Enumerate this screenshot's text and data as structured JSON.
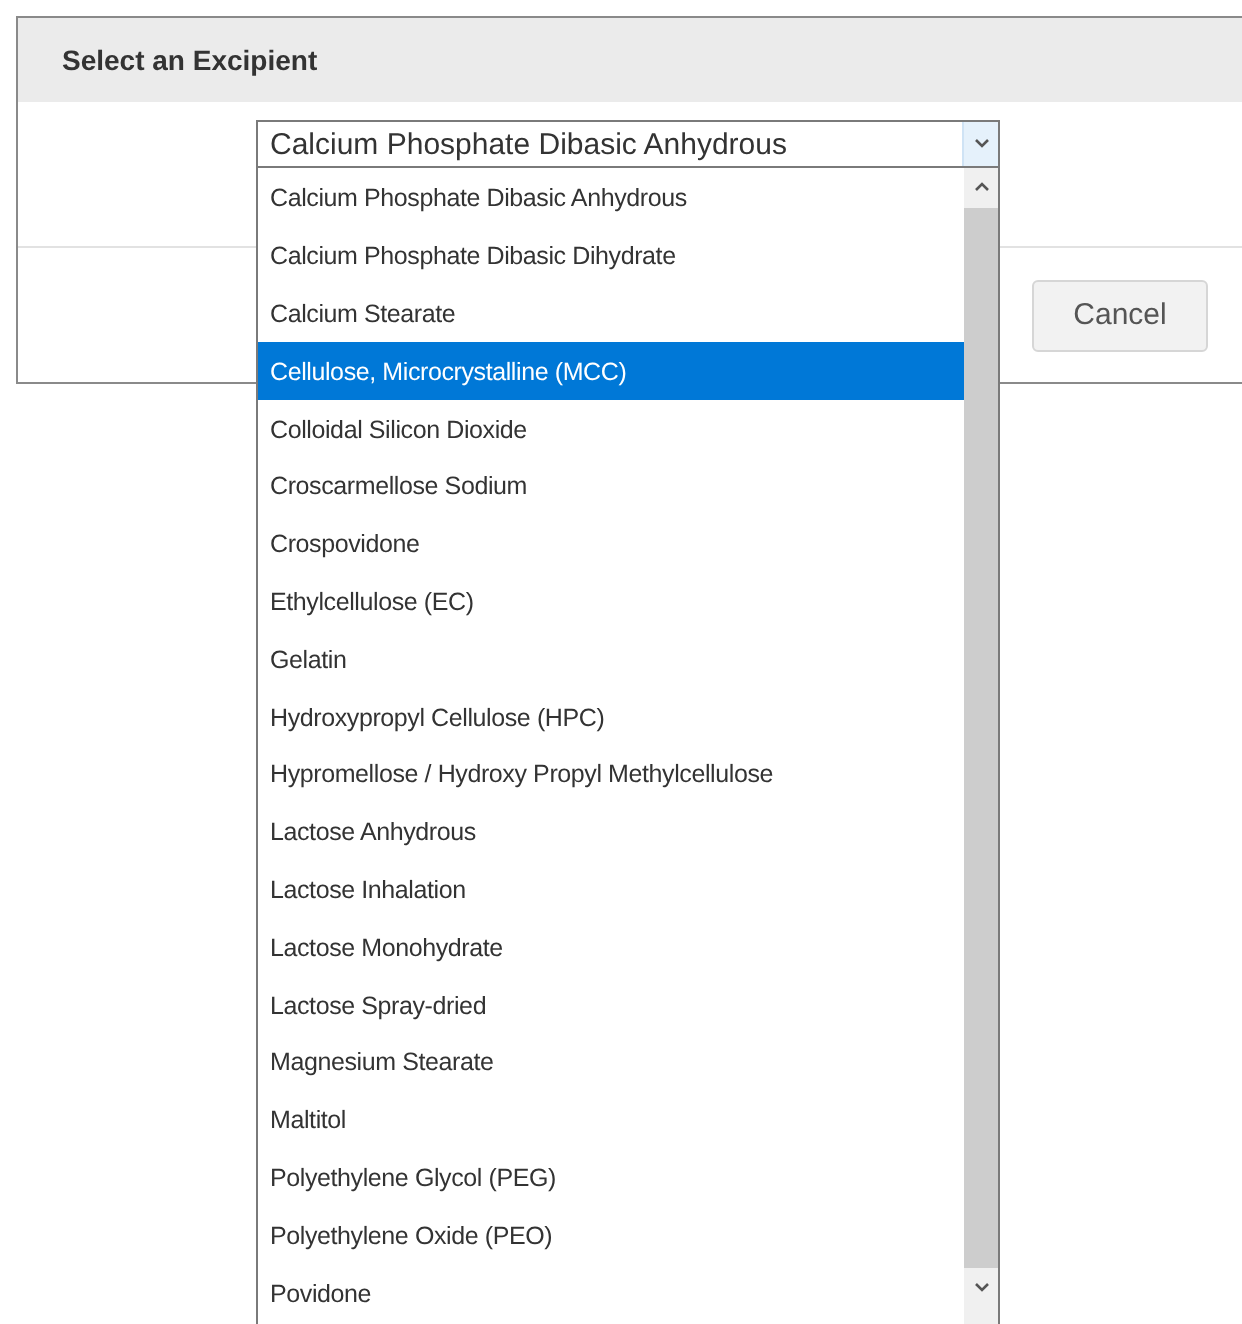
{
  "dialog": {
    "title": "Select an Excipient"
  },
  "combo": {
    "value": "Calcium Phosphate Dibasic Anhydrous",
    "options": [
      {
        "label": "Calcium Phosphate Dibasic Anhydrous",
        "highlighted": false
      },
      {
        "label": "Calcium Phosphate Dibasic Dihydrate",
        "highlighted": false
      },
      {
        "label": "Calcium Stearate",
        "highlighted": false
      },
      {
        "label": "Cellulose, Microcrystalline (MCC)",
        "highlighted": true
      },
      {
        "label": "Colloidal Silicon Dioxide",
        "highlighted": false
      },
      {
        "label": "Croscarmellose Sodium",
        "highlighted": false
      },
      {
        "label": "Crospovidone",
        "highlighted": false
      },
      {
        "label": "Ethylcellulose (EC)",
        "highlighted": false
      },
      {
        "label": "Gelatin",
        "highlighted": false
      },
      {
        "label": "Hydroxypropyl Cellulose (HPC)",
        "highlighted": false
      },
      {
        "label": "Hypromellose / Hydroxy Propyl Methylcellulose",
        "highlighted": false
      },
      {
        "label": "Lactose Anhydrous",
        "highlighted": false
      },
      {
        "label": "Lactose Inhalation",
        "highlighted": false
      },
      {
        "label": "Lactose Monohydrate",
        "highlighted": false
      },
      {
        "label": "Lactose Spray-dried",
        "highlighted": false
      },
      {
        "label": "Magnesium Stearate",
        "highlighted": false
      },
      {
        "label": "Maltitol",
        "highlighted": false
      },
      {
        "label": "Polyethylene Glycol (PEG)",
        "highlighted": false
      },
      {
        "label": "Polyethylene Oxide (PEO)",
        "highlighted": false
      },
      {
        "label": "Povidone",
        "highlighted": false
      }
    ]
  },
  "buttons": [
    "Cancel"
  ]
}
